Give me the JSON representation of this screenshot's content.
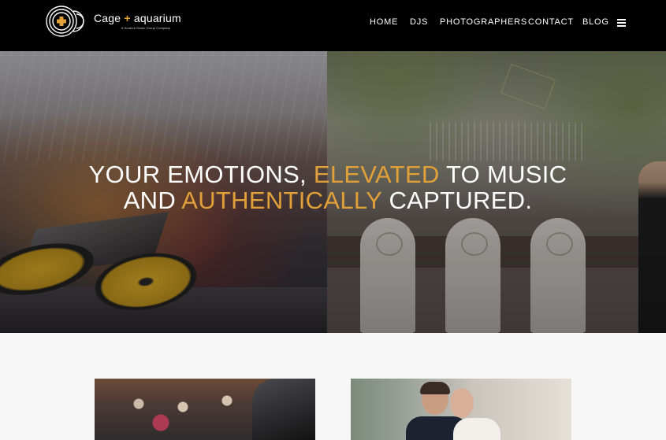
{
  "header": {
    "logo": {
      "brand": "Cage",
      "plus": "+",
      "brand2": "aquarium",
      "tagline": "A Scratch Music Group Company"
    },
    "nav": [
      "HOME",
      "DJS",
      "PHOTOGRAPHERS",
      "CONTACT",
      "BLOG"
    ],
    "menu_icon": "hamburger-menu-icon"
  },
  "hero": {
    "line1_a": "YOUR EMOTIONS, ",
    "line1_gold": "ELEVATED",
    "line1_b": " TO MUSIC",
    "line2_a": "AND ",
    "line2_gold": "AUTHENTICALLY",
    "line2_b": " CAPTURED."
  },
  "colors": {
    "accent": "#e2a039",
    "header_bg": "#000000",
    "page_bg": "#f7f7f7"
  }
}
